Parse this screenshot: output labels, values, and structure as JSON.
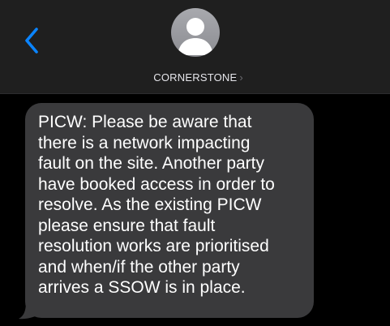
{
  "header": {
    "back_icon": "chevron-left-icon",
    "contact": {
      "name": "CORNERSTONE",
      "avatar_icon": "person-silhouette-icon",
      "disclosure_icon": "chevron-right-icon",
      "disclosure_glyph": "›"
    }
  },
  "thread": {
    "messages": [
      {
        "direction": "incoming",
        "text": "PICW: Please be aware that\nthere is a network impacting\nfault on the site. Another party\nhave booked access in order to\nresolve. As the existing PICW\nplease ensure that fault\nresolution works are prioritised\nand when/if the other party\narrives a SSOW is in place."
      }
    ]
  },
  "colors": {
    "header_bg": "#1f1f1f",
    "screen_bg": "#000000",
    "bubble_bg": "#3a3a3c",
    "accent_blue": "#0a84ff",
    "text_primary": "#ffffff",
    "text_secondary": "#e5e5ea"
  }
}
